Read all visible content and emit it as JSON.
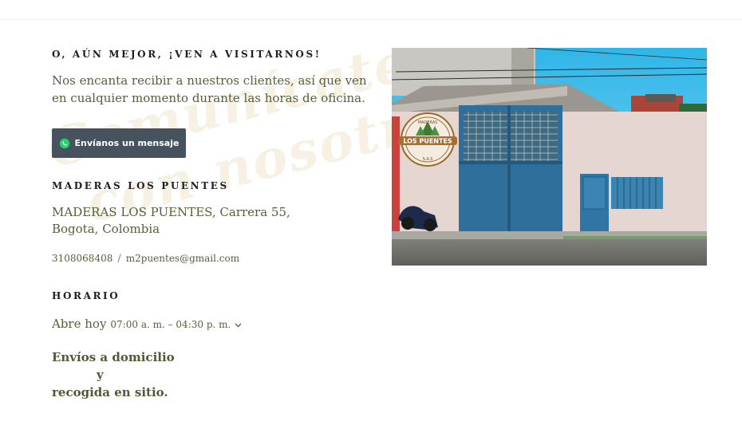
{
  "watermark": {
    "line1": "Comunícate",
    "line2": "con nosotros"
  },
  "visit": {
    "heading": "O, AÚN MEJOR, ¡VEN A VISITARNOS!",
    "intro": "Nos encanta recibir a nuestros clientes, así que ven en cualquier momento durante las horas de oficina."
  },
  "whatsapp_button": {
    "label": "Envíanos un mensaje",
    "icon": "whatsapp-icon",
    "color": "#46535e"
  },
  "business": {
    "heading": "MADERAS LOS PUENTES",
    "address_line1": "MADERAS LOS PUENTES, Carrera 55,",
    "address_line2": "Bogota, Colombia",
    "phone": "3108068408",
    "separator": "/",
    "email": "m2puentes@gmail.com"
  },
  "hours": {
    "heading": "HORARIO",
    "label": "Abre hoy",
    "time": "07:00 a. m. – 04:30 p. m."
  },
  "delivery": {
    "line1": "Envíos a domicilio",
    "line2": "y",
    "line3": "recogida en sitio."
  },
  "photo": {
    "logo_top": "MADERAS",
    "logo_main": "LOS PUENTES",
    "logo_bottom": "S.A.S"
  },
  "colors": {
    "text_green": "#55603a",
    "heading": "#1f1f1f",
    "button": "#46535e",
    "watermark": "#f7f1e4"
  }
}
